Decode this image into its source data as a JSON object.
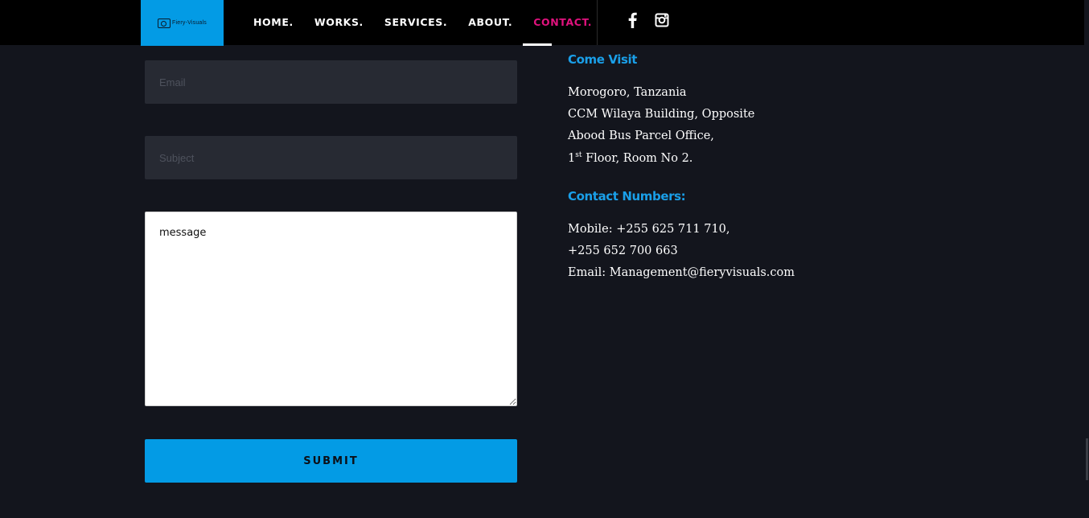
{
  "header": {
    "logo_text": "Fiery-Visuals",
    "nav": [
      {
        "label": "HOME.",
        "active": false
      },
      {
        "label": "WORKS.",
        "active": false
      },
      {
        "label": "SERVICES.",
        "active": false
      },
      {
        "label": "ABOUT.",
        "active": false
      },
      {
        "label": "CONTACT.",
        "active": true
      }
    ],
    "social": [
      {
        "icon": "facebook-icon"
      },
      {
        "icon": "instagram-icon"
      }
    ]
  },
  "form": {
    "email_placeholder": "Email",
    "email_value": "",
    "subject_placeholder": "Subject",
    "subject_value": "",
    "message_placeholder": "message",
    "message_value": "",
    "submit_label": "SUBMIT"
  },
  "contact": {
    "visit_heading": "Come Visit",
    "address_line1": "Morogoro, Tanzania",
    "address_line2": "CCM Wilaya Building, Opposite",
    "address_line3": "Abood Bus Parcel Office,",
    "address_line4_num": "1",
    "address_line4_sup": "st",
    "address_line4_rest": " Floor, Room No 2.",
    "numbers_heading": "Contact Numbers:",
    "mobile_line1": "Mobile: +255 625 711 710,",
    "mobile_line2": "+255 652 700 663",
    "email_line": "Email: Management@fieryvisuals.com"
  },
  "colors": {
    "accent_blue": "#039be5",
    "active_nav": "#e1127e",
    "background": "#13151d"
  }
}
